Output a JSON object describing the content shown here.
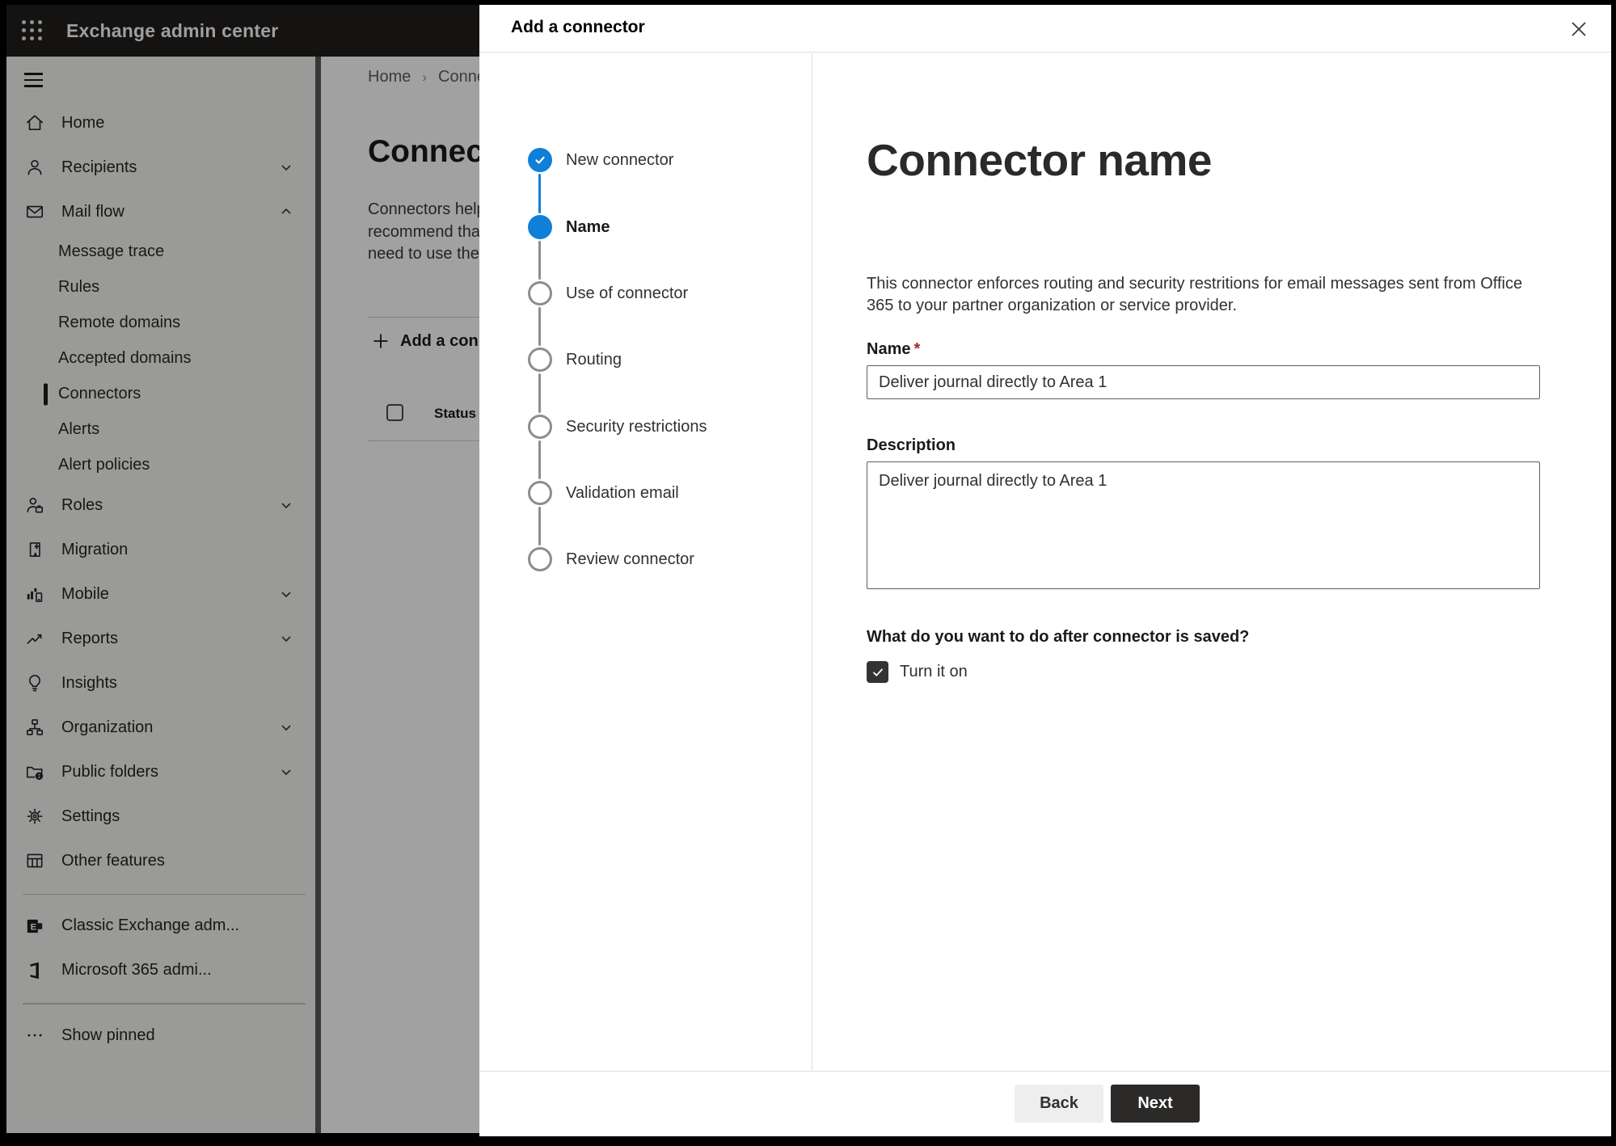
{
  "topbar": {
    "title": "Exchange admin center"
  },
  "sidebar": {
    "items": [
      {
        "label": "Home",
        "icon": "home-icon"
      },
      {
        "label": "Recipients",
        "icon": "person-icon",
        "chevron": "down"
      },
      {
        "label": "Mail flow",
        "icon": "mail-icon",
        "chevron": "up",
        "expanded": true
      },
      {
        "label": "Message trace",
        "type": "sub"
      },
      {
        "label": "Rules",
        "type": "sub"
      },
      {
        "label": "Remote domains",
        "type": "sub"
      },
      {
        "label": "Accepted domains",
        "type": "sub"
      },
      {
        "label": "Connectors",
        "type": "sub",
        "selected": true
      },
      {
        "label": "Alerts",
        "type": "sub"
      },
      {
        "label": "Alert policies",
        "type": "sub"
      },
      {
        "label": "Roles",
        "icon": "roles-icon",
        "chevron": "down"
      },
      {
        "label": "Migration",
        "icon": "migration-icon"
      },
      {
        "label": "Mobile",
        "icon": "mobile-icon",
        "chevron": "down"
      },
      {
        "label": "Reports",
        "icon": "reports-icon",
        "chevron": "down"
      },
      {
        "label": "Insights",
        "icon": "lightbulb-icon"
      },
      {
        "label": "Organization",
        "icon": "org-chart-icon",
        "chevron": "down"
      },
      {
        "label": "Public folders",
        "icon": "folder-globe-icon",
        "chevron": "down"
      },
      {
        "label": "Settings",
        "icon": "gear-icon"
      },
      {
        "label": "Other features",
        "icon": "table-icon"
      },
      {
        "label": "Classic Exchange adm...",
        "icon": "exchange-logo-icon"
      },
      {
        "label": "Microsoft 365 admi...",
        "icon": "office-logo-icon"
      },
      {
        "label": "Show pinned",
        "icon": "ellipsis-icon"
      }
    ]
  },
  "background_page": {
    "breadcrumb": {
      "home": "Home",
      "current": "Conne"
    },
    "heading": "Connec",
    "paragraph_lines": [
      "Connectors help",
      "recommend that",
      "need to use ther"
    ],
    "add_button": "Add a conn",
    "table": {
      "status_header": "Status"
    }
  },
  "dialog": {
    "title": "Add a connector",
    "steps": [
      {
        "label": "New connector",
        "state": "complete"
      },
      {
        "label": "Name",
        "state": "current"
      },
      {
        "label": "Use of connector",
        "state": "upcoming"
      },
      {
        "label": "Routing",
        "state": "upcoming"
      },
      {
        "label": "Security restrictions",
        "state": "upcoming"
      },
      {
        "label": "Validation email",
        "state": "upcoming"
      },
      {
        "label": "Review connector",
        "state": "upcoming"
      }
    ],
    "content": {
      "heading": "Connector name",
      "description": "This connector enforces routing and security restritions for email messages sent from Office 365 to your partner organization or service provider.",
      "name_label": "Name",
      "required_mark": "*",
      "name_value": "Deliver journal directly to Area 1",
      "description_label": "Description",
      "description_value": "Deliver journal directly to Area 1",
      "after_save_question": "What do you want to do after connector is saved?",
      "turn_on_label": "Turn it on",
      "turn_on_checked": true
    },
    "footer": {
      "back": "Back",
      "next": "Next"
    }
  },
  "colors": {
    "accent_blue": "#0f7fd8",
    "dark_button": "#2b2a29",
    "required_red": "#a4262c",
    "divider": "#e1dfdd",
    "input_border": "#605e5c"
  }
}
